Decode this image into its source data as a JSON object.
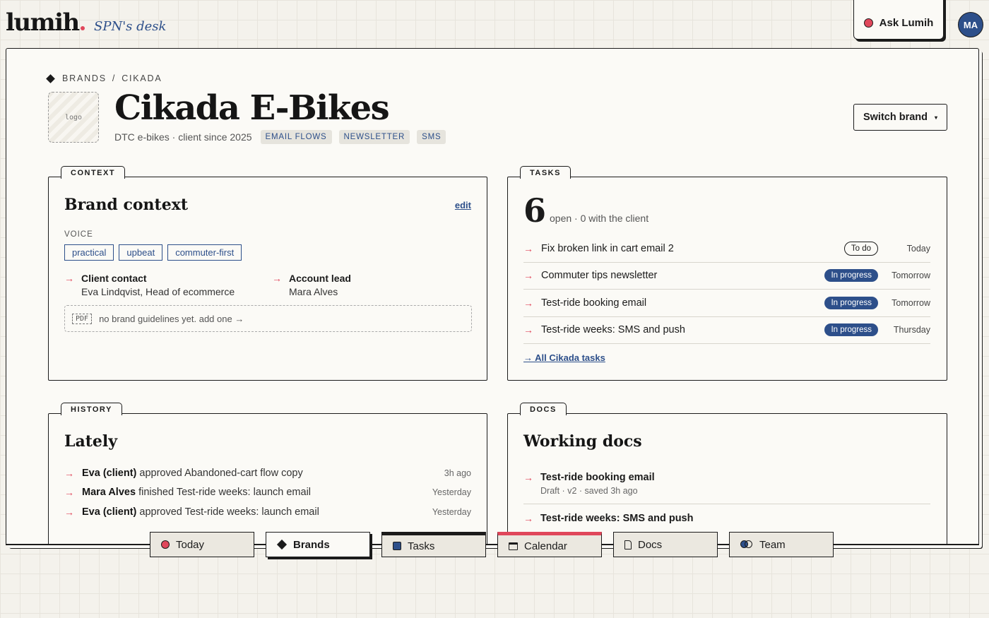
{
  "app": {
    "logo": "lumih",
    "desk_label": "SPN's desk"
  },
  "header": {
    "ask_label": "Ask Lumih",
    "avatar_initials": "MA"
  },
  "breadcrumb": {
    "section": "BRANDS",
    "separator": "/",
    "current": "CIKADA"
  },
  "brand": {
    "logo_placeholder": "logo",
    "name": "Cikada E-Bikes",
    "description": "DTC e-bikes · client since 2025",
    "tags": [
      "EMAIL FLOWS",
      "NEWSLETTER",
      "SMS"
    ],
    "switch_label": "Switch brand",
    "switch_caret": "▾"
  },
  "context": {
    "tab": "CONTEXT",
    "title": "Brand context",
    "edit_label": "edit",
    "voice_label": "VOICE",
    "voice": [
      "practical",
      "upbeat",
      "commuter-first"
    ],
    "client_contact_label": "Client contact",
    "client_contact_value": "Eva Lindqvist, Head of ecommerce",
    "account_lead_label": "Account lead",
    "account_lead_value": "Mara Alves",
    "pdf_icon": "PDF",
    "guidelines_text": "no brand guidelines yet. add one →"
  },
  "tasks": {
    "tab": "TASKS",
    "open_count": "6",
    "open_text": "open · 0 with the client",
    "items": [
      {
        "name": "Fix broken link in cart email 2",
        "status": "To do",
        "when": "Today"
      },
      {
        "name": "Commuter tips newsletter",
        "status": "In progress",
        "when": "Tomorrow"
      },
      {
        "name": "Test-ride booking email",
        "status": "In progress",
        "when": "Tomorrow"
      },
      {
        "name": "Test-ride weeks: SMS and push",
        "status": "In progress",
        "when": "Thursday"
      }
    ],
    "all_link": "→ All Cikada tasks"
  },
  "history": {
    "tab": "HISTORY",
    "title": "Lately",
    "items": [
      {
        "actor": "Eva (client)",
        "action": "approved Abandoned-cart flow copy",
        "when": "3h ago"
      },
      {
        "actor": "Mara Alves",
        "action": "finished Test-ride weeks: launch email",
        "when": "Yesterday"
      },
      {
        "actor": "Eva (client)",
        "action": "approved Test-ride weeks: launch email",
        "when": "Yesterday"
      }
    ]
  },
  "docs": {
    "tab": "DOCS",
    "title": "Working docs",
    "items": [
      {
        "name": "Test-ride booking email",
        "meta": "Draft · v2 · saved 3h ago"
      },
      {
        "name": "Test-ride weeks: SMS and push",
        "meta": ""
      }
    ]
  },
  "nav": {
    "today": "Today",
    "brands": "Brands",
    "tasks": "Tasks",
    "calendar": "Calendar",
    "docs": "Docs",
    "team": "Team"
  },
  "colors": {
    "accent_red": "#e0475b",
    "brand_blue": "#2d4f8a",
    "ink": "#1b1b1b",
    "paper": "#fbfaf6"
  },
  "icons": {
    "today": "red-dot-icon",
    "brands": "diamond-icon",
    "tasks": "square-icon",
    "calendar": "calendar-icon",
    "docs": "doc-icon",
    "team": "team-icon"
  }
}
